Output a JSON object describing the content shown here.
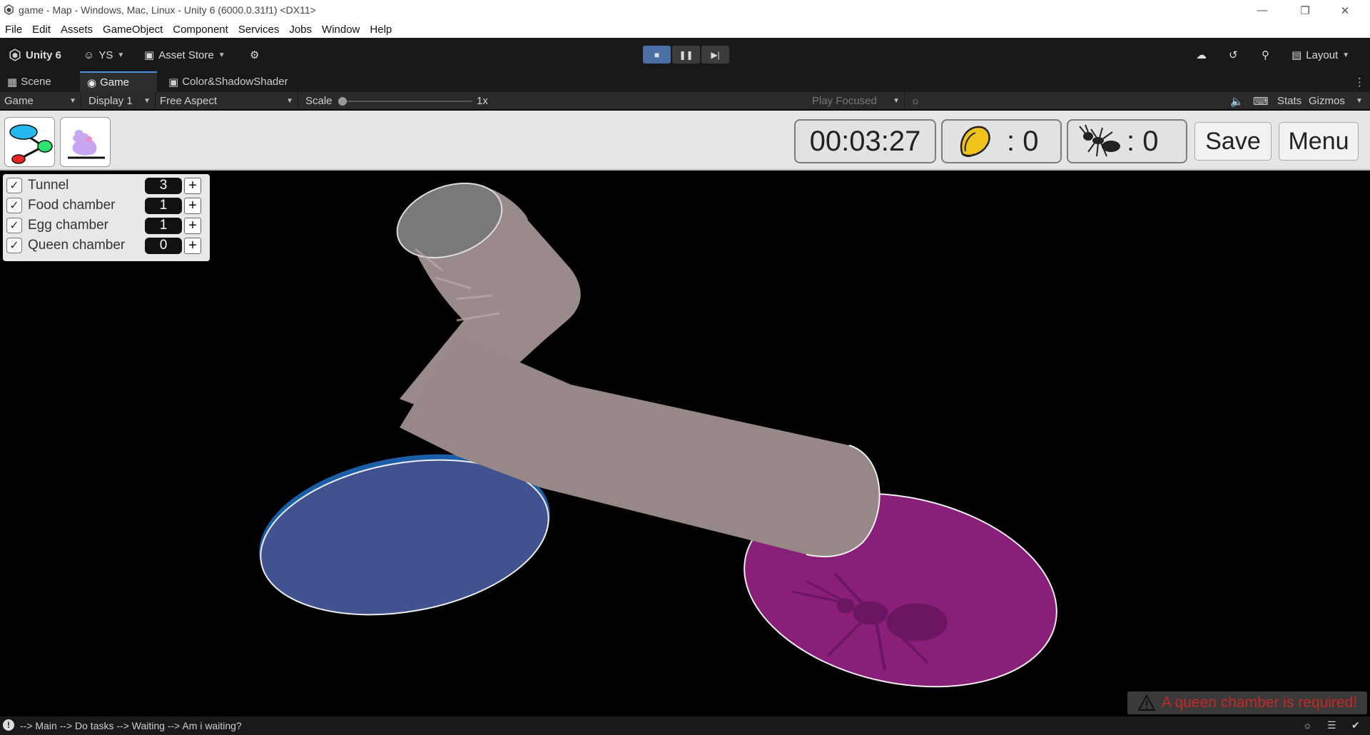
{
  "window": {
    "title": "game - Map - Windows, Mac, Linux - Unity 6 (6000.0.31f1) <DX11>"
  },
  "menu": [
    "File",
    "Edit",
    "Assets",
    "GameObject",
    "Component",
    "Services",
    "Jobs",
    "Window",
    "Help"
  ],
  "toolbar": {
    "unity_label": "Unity 6",
    "account_label": "YS",
    "asset_store_label": "Asset Store",
    "layout_label": "Layout"
  },
  "tabs": {
    "scene": "Scene",
    "game": "Game",
    "shader": "Color&ShadowShader"
  },
  "game_toolbar": {
    "view": "Game",
    "display": "Display 1",
    "aspect": "Free Aspect",
    "scale_label": "Scale",
    "scale_value": "1x",
    "play_mode": "Play Focused",
    "stats": "Stats",
    "gizmos": "Gizmos"
  },
  "hud": {
    "timer": "00:03:27",
    "food_count": ": 0",
    "ant_count": ": 0",
    "save_label": "Save",
    "menu_label": "Menu"
  },
  "checklist": [
    {
      "label": "Tunnel",
      "count": "3",
      "plus": "+"
    },
    {
      "label": "Food chamber",
      "count": "1",
      "plus": "+"
    },
    {
      "label": "Egg chamber",
      "count": "1",
      "plus": "+"
    },
    {
      "label": "Queen chamber",
      "count": "0",
      "plus": "+"
    }
  ],
  "warning": "A queen chamber is required!",
  "status": "--> Main --> Do tasks --> Waiting --> Am i waiting?",
  "colors": {
    "tunnel": "#968888",
    "food_chamber": "#3f5590",
    "queen_chamber": "#8a1f7a",
    "warning_text": "#c62828"
  }
}
